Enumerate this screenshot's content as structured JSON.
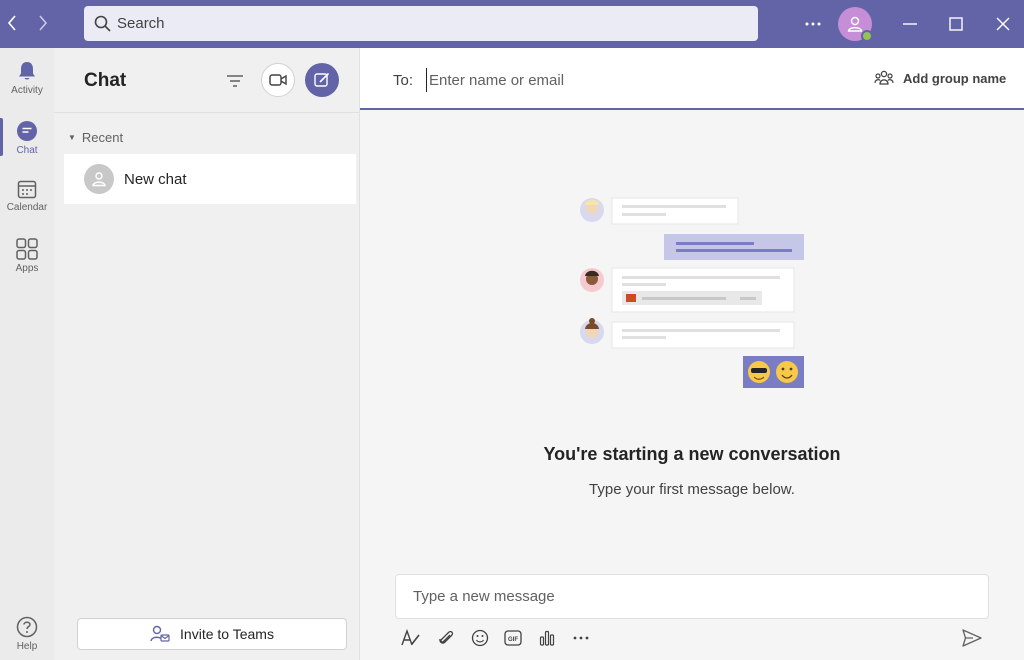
{
  "search": {
    "placeholder": "Search"
  },
  "rail": {
    "items": [
      {
        "label": "Activity"
      },
      {
        "label": "Chat"
      },
      {
        "label": "Calendar"
      },
      {
        "label": "Apps"
      },
      {
        "label": "Help"
      }
    ]
  },
  "chat_panel": {
    "title": "Chat",
    "recent_label": "Recent",
    "items": [
      {
        "name": "New chat"
      }
    ],
    "invite_label": "Invite to Teams"
  },
  "main": {
    "to_label": "To:",
    "to_placeholder": "Enter name or email",
    "add_group_label": "Add group name",
    "empty_title": "You're starting a new conversation",
    "empty_subtitle": "Type your first message below.",
    "compose_placeholder": "Type a new message"
  },
  "colors": {
    "brand": "#6264a7",
    "presence_available": "#92c353",
    "avatar": "#c58ed6"
  }
}
